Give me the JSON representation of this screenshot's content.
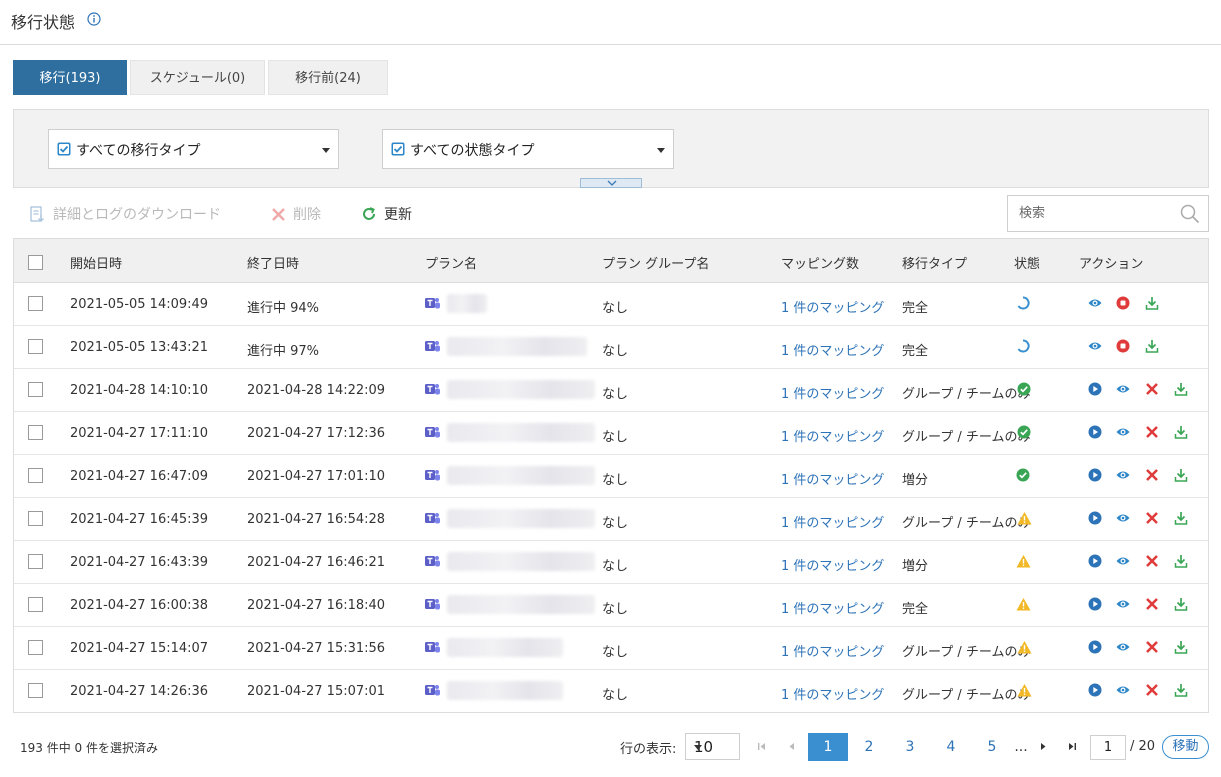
{
  "header": {
    "title": "移行状態",
    "info_icon": "info-icon"
  },
  "tabs": [
    {
      "label": "移行(193)",
      "active": true
    },
    {
      "label": "スケジュール(0)",
      "active": false
    },
    {
      "label": "移行前(24)",
      "active": false
    }
  ],
  "filters": {
    "migration_type": "すべての移行タイプ",
    "status_type": "すべての状態タイプ"
  },
  "toolbar": {
    "download_label": "詳細とログのダウンロード",
    "delete_label": "削除",
    "refresh_label": "更新",
    "search_placeholder": "検索"
  },
  "table": {
    "columns": [
      "開始日時",
      "終了日時",
      "プラン名",
      "プラン グループ名",
      "マッピング数",
      "移行タイプ",
      "状態",
      "アクション"
    ],
    "rows": [
      {
        "start": "2021-05-05 14:09:49",
        "end": "進行中 94%",
        "group": "なし",
        "mappings": "1 件のマッピング",
        "type": "完全",
        "status": "in-progress",
        "status_inline": false,
        "actions": [
          "view",
          "stop",
          "download"
        ]
      },
      {
        "start": "2021-05-05 13:43:21",
        "end": "進行中 97%",
        "group": "なし",
        "mappings": "1 件のマッピング",
        "type": "完全",
        "status": "in-progress",
        "status_inline": false,
        "actions": [
          "view",
          "stop",
          "download"
        ]
      },
      {
        "start": "2021-04-28 14:10:10",
        "end": "2021-04-28 14:22:09",
        "group": "なし",
        "mappings": "1 件のマッピング",
        "type": "グループ / チームのみ",
        "status": "success",
        "status_inline": true,
        "actions": [
          "run",
          "view",
          "delete",
          "download"
        ]
      },
      {
        "start": "2021-04-27 17:11:10",
        "end": "2021-04-27 17:12:36",
        "group": "なし",
        "mappings": "1 件のマッピング",
        "type": "グループ / チームのみ",
        "status": "success",
        "status_inline": true,
        "actions": [
          "run",
          "view",
          "delete",
          "download"
        ]
      },
      {
        "start": "2021-04-27 16:47:09",
        "end": "2021-04-27 17:01:10",
        "group": "なし",
        "mappings": "1 件のマッピング",
        "type": "増分",
        "status": "success",
        "status_inline": false,
        "actions": [
          "run",
          "view",
          "delete",
          "download"
        ]
      },
      {
        "start": "2021-04-27 16:45:39",
        "end": "2021-04-27 16:54:28",
        "group": "なし",
        "mappings": "1 件のマッピング",
        "type": "グループ / チームのみ",
        "status": "warning",
        "status_inline": true,
        "actions": [
          "run",
          "view",
          "delete",
          "download"
        ]
      },
      {
        "start": "2021-04-27 16:43:39",
        "end": "2021-04-27 16:46:21",
        "group": "なし",
        "mappings": "1 件のマッピング",
        "type": "増分",
        "status": "warning",
        "status_inline": false,
        "actions": [
          "run",
          "view",
          "delete",
          "download"
        ]
      },
      {
        "start": "2021-04-27 16:00:38",
        "end": "2021-04-27 16:18:40",
        "group": "なし",
        "mappings": "1 件のマッピング",
        "type": "完全",
        "status": "warning",
        "status_inline": false,
        "actions": [
          "run",
          "view",
          "delete",
          "download"
        ]
      },
      {
        "start": "2021-04-27 15:14:07",
        "end": "2021-04-27 15:31:56",
        "group": "なし",
        "mappings": "1 件のマッピング",
        "type": "グループ / チームのみ",
        "status": "warning",
        "status_inline": true,
        "actions": [
          "run",
          "view",
          "delete",
          "download"
        ]
      },
      {
        "start": "2021-04-27 14:26:36",
        "end": "2021-04-27 15:07:01",
        "group": "なし",
        "mappings": "1 件のマッピング",
        "type": "グループ / チームのみ",
        "status": "warning",
        "status_inline": true,
        "actions": [
          "run",
          "view",
          "delete",
          "download"
        ]
      }
    ]
  },
  "footer": {
    "selection_text": "193 件中 0 件を選択済み",
    "rows_label": "行の表示:",
    "rows_value": "10",
    "pages": [
      "1",
      "2",
      "3",
      "4",
      "5"
    ],
    "current_page": "1",
    "ellipsis": "...",
    "page_input": "1",
    "total_pages": "/ 20",
    "go_label": "移動"
  },
  "colors": {
    "accent": "#2f6f9f",
    "link": "#2d73b8",
    "success": "#3aa655",
    "warning": "#f2b825",
    "danger": "#e03b3b",
    "download": "#3aa655",
    "teams": "#5b5fc7"
  }
}
